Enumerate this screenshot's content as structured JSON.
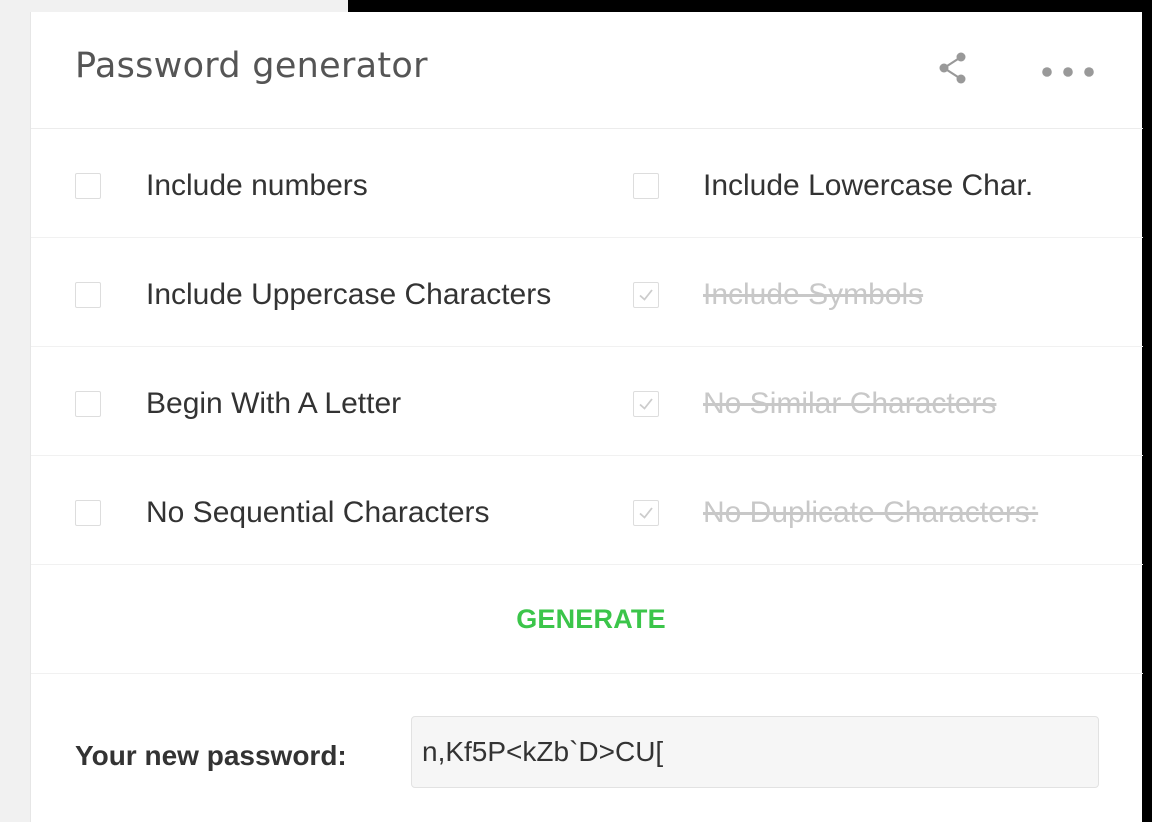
{
  "card": {
    "title": "Password generator",
    "actions": {
      "share_icon": "share-icon",
      "more_icon": "more-horizontal-icon"
    }
  },
  "options": {
    "left": [
      {
        "label": "Include numbers",
        "checked": false,
        "disabled": false
      },
      {
        "label": "Include Uppercase Characters",
        "checked": false,
        "disabled": false
      },
      {
        "label": "Begin With A Letter",
        "checked": false,
        "disabled": false
      },
      {
        "label": "No Sequential Characters",
        "checked": false,
        "disabled": false
      }
    ],
    "right": [
      {
        "label": "Include Lowercase Char.",
        "checked": false,
        "disabled": false
      },
      {
        "label": "Include Symbols",
        "checked": true,
        "disabled": true
      },
      {
        "label": "No Similar Characters",
        "checked": true,
        "disabled": true
      },
      {
        "label": "No Duplicate Characters:",
        "checked": true,
        "disabled": true
      }
    ]
  },
  "generate": {
    "label": "GENERATE"
  },
  "result": {
    "label": "Your new password:",
    "value": "n,Kf5P<kZb`D>CU["
  },
  "colors": {
    "accent_green": "#3bc54a",
    "text_primary": "#333333",
    "text_disabled": "#c8c8c8",
    "page_bg_left": "#f1f1f1",
    "page_bg_right": "#000000"
  }
}
